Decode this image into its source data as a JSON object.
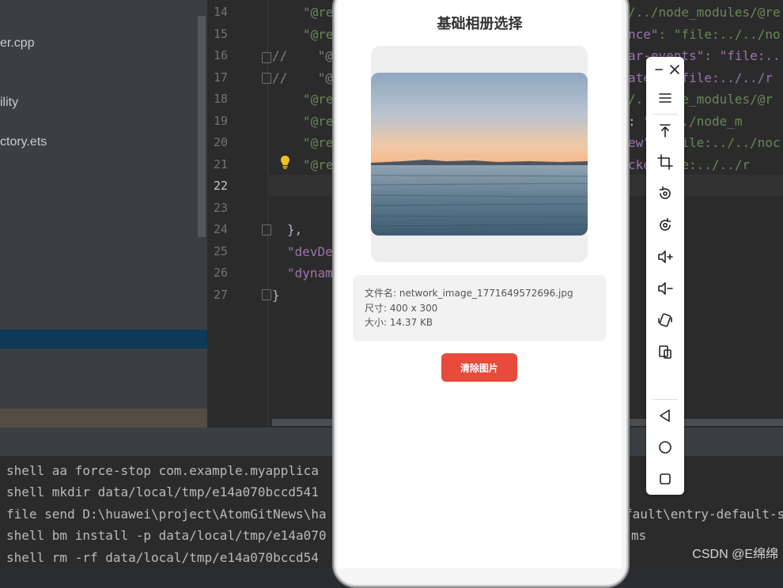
{
  "ide": {
    "files": [
      "er.cpp",
      "ility",
      "ctory.ets"
    ],
    "line_numbers": [
      "14",
      "15",
      "16",
      "17",
      "18",
      "19",
      "20",
      "21",
      "22",
      "23",
      "24",
      "25",
      "26",
      "27"
    ],
    "active_line": "22",
    "code": {
      "l14": "\"@re",
      "l15": "\"@re",
      "l16": "//    \"@",
      "l17": "//    \"@",
      "l18": "\"@re",
      "l19": "\"@re",
      "l20": "\"@re",
      "l21": "\"@re",
      "l24": "},",
      "l25": "\"devDe",
      "l26": "\"dynam",
      "l27": "}"
    },
    "code_right": {
      "l14": "/../node_modules/@re",
      "l15a": "nce\"",
      "l15b": ": \"file:../../no",
      "l16": "ar-events\": \"file:..",
      "l17": "ate\": \"file:../../r",
      "l18": "/../node_modules/@r",
      "l19a": ": ",
      "l19b": "\"../../node_m",
      "l20a": "ew\"",
      "l20b": ": \"file:../../noc",
      "l21a": "cke",
      "l21b": "\"file:../../r"
    },
    "terminal": [
      "shell aa force-stop com.example.myapplica",
      "shell mkdir data/local/tmp/e14a070bccd541",
      "file send D:\\huawei\\project\\AtomGitNews\\ha",
      "shell bm install -p data/local/tmp/e14a070",
      "shell rm -rf data/local/tmp/e14a070bccd54"
    ],
    "terminal_right": [
      "fault\\entry-default-s",
      "ms"
    ],
    "watermark": "CSDN @E绵绵"
  },
  "app": {
    "title": "基础相册选择",
    "file_name": "文件名: network_image_1771649572696.jpg",
    "dimensions": "尺寸: 400 x 300",
    "size": "大小: 14.37 KB",
    "clear_button": "清除图片"
  },
  "toolbar": {
    "icons": [
      "minimize-icon",
      "close-icon",
      "menu-icon",
      "pin-top-icon",
      "crop-icon",
      "rotate-icon",
      "screenshot-icon",
      "volume-up-icon",
      "volume-down-icon",
      "shake-icon",
      "multi-screen-icon",
      "back-icon",
      "home-icon",
      "recents-icon"
    ]
  },
  "colors": {
    "accent_button": "#e84a3b",
    "ide_bg": "#2b2b2b",
    "string_green": "#6a8759"
  }
}
